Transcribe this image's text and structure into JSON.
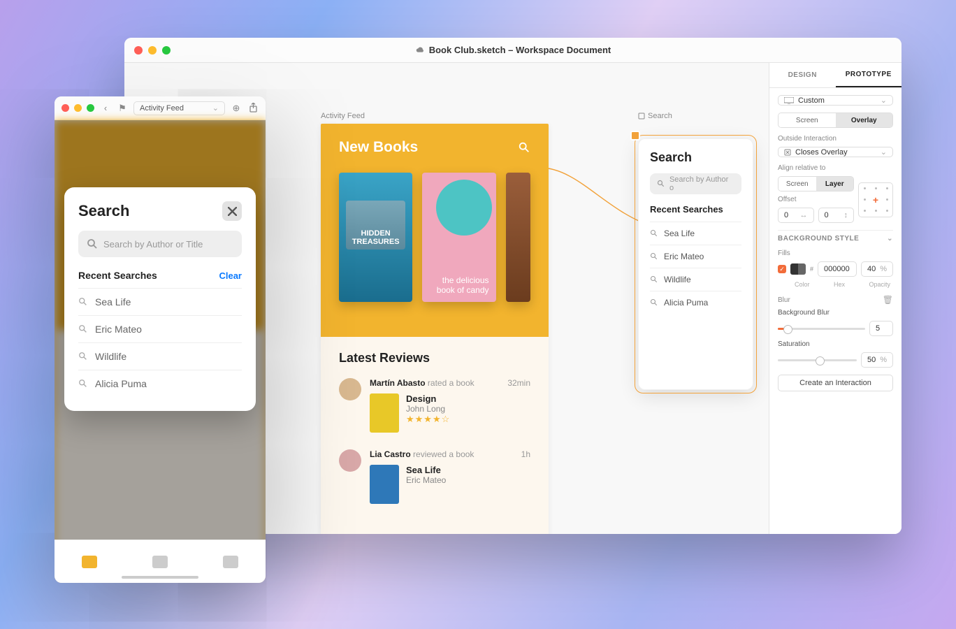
{
  "main": {
    "title": "Book Club.sketch – Workspace Document",
    "artboards": {
      "feed_label": "Activity Feed",
      "search_label": "Search"
    },
    "feed": {
      "hero_title": "New Books",
      "books": [
        {
          "title": "HIDDEN TREASURES"
        },
        {
          "title": "the delicious book of candy"
        },
        {
          "title": ""
        }
      ],
      "reviews_title": "Latest Reviews",
      "reviews": [
        {
          "name": "Martín Abasto",
          "action": "rated a book",
          "time": "32min",
          "book_title": "Design",
          "book_author": "John Long",
          "stars": "★★★★☆"
        },
        {
          "name": "Lia Castro",
          "action": "reviewed a book",
          "time": "1h",
          "book_title": "Sea Life",
          "book_author": "Eric Mateo",
          "stars": ""
        }
      ]
    },
    "search_overlay": {
      "title": "Search",
      "placeholder": "Search by Author o",
      "recent_title": "Recent Searches",
      "items": [
        "Sea Life",
        "Eric Mateo",
        "Wildlife",
        "Alicia Puma"
      ]
    }
  },
  "inspector": {
    "tabs": {
      "design": "DESIGN",
      "prototype": "PROTOTYPE"
    },
    "screen_type": "Custom",
    "seg1": [
      "Screen",
      "Overlay"
    ],
    "outside_label": "Outside Interaction",
    "outside_value": "Closes Overlay",
    "align_label": "Align relative to",
    "seg2": [
      "Screen",
      "Layer"
    ],
    "offset_label": "Offset",
    "offset_x": "0",
    "offset_y": "0",
    "bg_section": "BACKGROUND STYLE",
    "fills_label": "Fills",
    "fill_hex": "000000",
    "fill_opacity": "40",
    "fill_opacity_unit": "%",
    "fill_color_label": "Color",
    "fill_hex_label": "Hex",
    "fill_opacity_label": "Opacity",
    "blur_label": "Blur",
    "blur_type": "Background Blur",
    "blur_value": "5",
    "sat_label": "Saturation",
    "sat_value": "50",
    "sat_unit": "%",
    "cta": "Create an Interaction"
  },
  "preview": {
    "artboard": "Activity Feed",
    "overlay": {
      "title": "Search",
      "placeholder": "Search by Author or Title",
      "recent_title": "Recent Searches",
      "clear": "Clear",
      "items": [
        "Sea Life",
        "Eric Mateo",
        "Wildlife",
        "Alicia Puma"
      ]
    }
  }
}
